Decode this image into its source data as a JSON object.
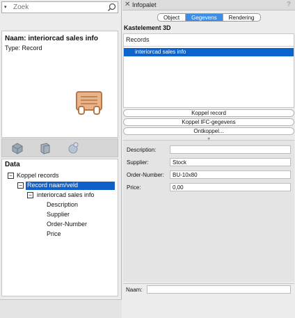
{
  "search": {
    "placeholder": "Zoek"
  },
  "resource": {
    "name": "Naam: interiorcad sales info",
    "type": "Type: Record"
  },
  "data_panel": {
    "title": "Data",
    "tree": [
      {
        "label": "Koppel records"
      },
      {
        "label": "Record naam/veld"
      },
      {
        "label": "interiorcad sales info"
      },
      {
        "label": "Description"
      },
      {
        "label": "Supplier"
      },
      {
        "label": "Order-Number"
      },
      {
        "label": "Price"
      }
    ]
  },
  "palette": {
    "title": "Infopalet",
    "help": "?",
    "tabs": [
      "Object",
      "Gegevens",
      "Rendering"
    ],
    "object_title": "Kastelement 3D",
    "records_header": "Records",
    "records": [
      "interiorcad sales info"
    ],
    "buttons": {
      "attach": "Koppel record",
      "ifc": "Koppel IFC-gegevens",
      "detach": "Ontkoppel..."
    },
    "fields": [
      {
        "label": "Description:",
        "value": ""
      },
      {
        "label": "Supplier:",
        "value": "Stock"
      },
      {
        "label": "Order-Number:",
        "value": "BU-10x80"
      },
      {
        "label": "Price:",
        "value": "0,00"
      }
    ],
    "name_label": "Naam:",
    "name_value": ""
  },
  "colors": {
    "selection": "#0b63ce",
    "active_tab": "#3b8ee8",
    "record_icon": "#c78a5a"
  }
}
